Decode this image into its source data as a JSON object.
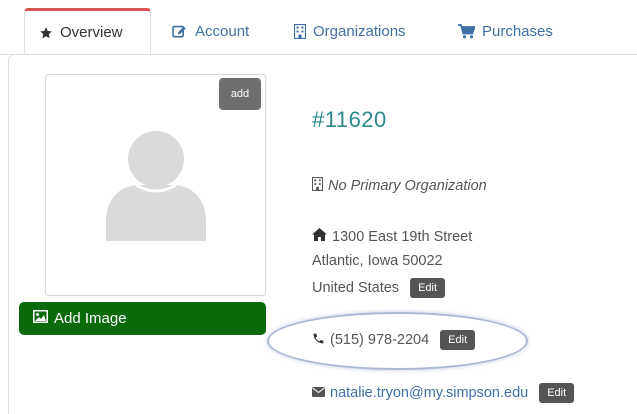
{
  "tabs": [
    {
      "label": "Overview",
      "icon": "star-icon",
      "active": true
    },
    {
      "label": "Account",
      "icon": "edit-icon",
      "active": false
    },
    {
      "label": "Organizations",
      "icon": "building-icon",
      "active": false
    },
    {
      "label": "Purchases",
      "icon": "cart-icon",
      "active": false
    }
  ],
  "avatar": {
    "add_label": "add",
    "add_image_label": "Add Image"
  },
  "contact": {
    "id": "#11620",
    "organization": "No Primary Organization",
    "address_line1": "1300 East 19th Street",
    "address_line2": "Atlantic, Iowa 50022",
    "address_line3": "United States",
    "phone": "(515) 978-2204",
    "email": "natalie.tryon@my.simpson.edu"
  },
  "buttons": {
    "edit_label": "Edit"
  },
  "colors": {
    "active_tab_border": "#d9534f",
    "link": "#3f6fa6",
    "id_text": "#2b8a8a",
    "add_image_bg": "#0b6a0b",
    "edit_bg": "#555555"
  }
}
